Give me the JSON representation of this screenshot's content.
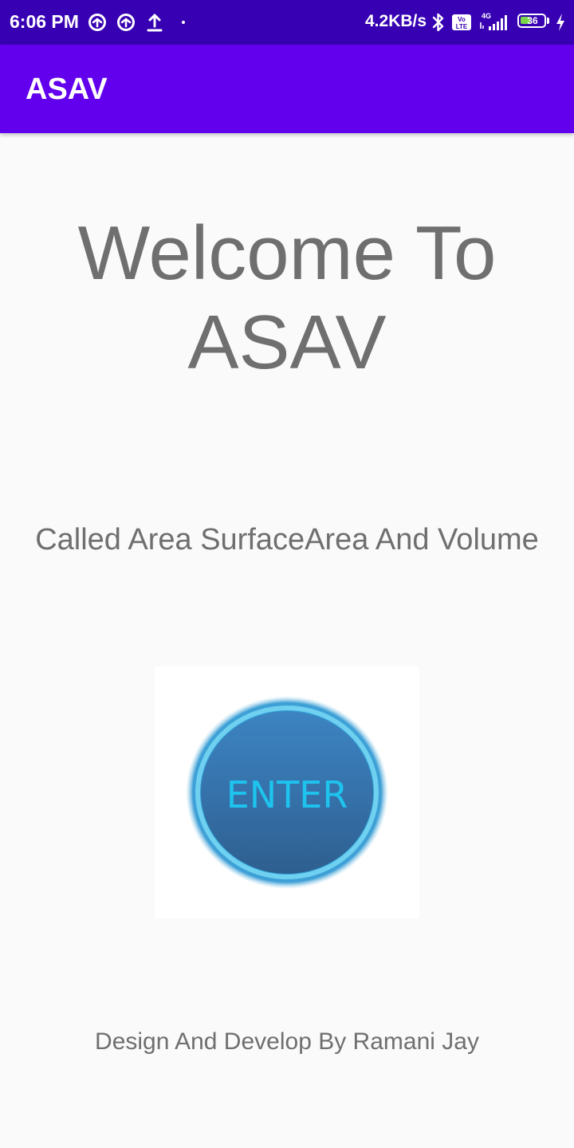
{
  "status_bar": {
    "time": "6:06 PM",
    "left_icons": [
      "data-saver-icon",
      "data-saver-icon",
      "upload-icon",
      "dot-icon"
    ],
    "network_speed": "4.2KB/s",
    "right_icons": [
      "bluetooth-icon",
      "volte-icon",
      "signal-4g-icon",
      "battery-icon",
      "charging-icon"
    ],
    "network_label": "4G",
    "volte_label": "Vo LTE",
    "battery_level": "36",
    "colors": {
      "background": "#3700b3",
      "battery_fill": "#7bd64a"
    }
  },
  "app_bar": {
    "title": "ASAV",
    "background": "#6200ee"
  },
  "main": {
    "welcome_line1": "Welcome To",
    "welcome_line2": "ASAV",
    "subtitle": "Called Area SurfaceArea And Volume",
    "enter_button_label": "ENTER",
    "footer": "Design And Develop By Ramani Jay"
  }
}
